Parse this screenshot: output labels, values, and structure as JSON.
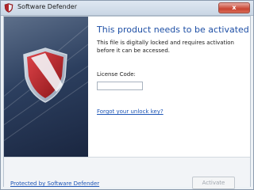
{
  "window": {
    "title": "Software Defender",
    "close_label": "x"
  },
  "icons": {
    "app": "shield-icon",
    "close": "close-icon"
  },
  "main": {
    "heading": "This product needs to be activated",
    "description": "This file is digitally locked and requires activation before it can be accessed.",
    "license_label": "License Code:",
    "license_value": "",
    "license_placeholder": "",
    "forgot_link": "Forgot your unlock key?"
  },
  "footer": {
    "protected_link": "Protected by Software Defender",
    "activate_label": "Activate",
    "activate_enabled": false
  },
  "colors": {
    "heading": "#1e4fa5",
    "link": "#1d55b6",
    "shield_red": "#b3262b",
    "panel_dark": "#1a2640"
  }
}
